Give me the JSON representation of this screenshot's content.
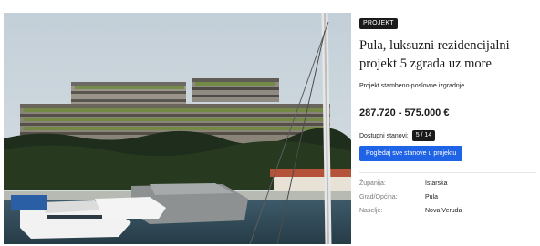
{
  "badge": "PROJEKT",
  "title": "Pula, luksuzni rezidencijalni projekt 5 zgrada uz more",
  "subtitle": "Projekt stambeno-poslovne izgradnje",
  "price": "287.720 - 575.000 €",
  "availability": {
    "label": "Dostupni stanovi:",
    "count": "5 / 14"
  },
  "cta_label": "Pogledaj sve stanove u projektu",
  "details": [
    {
      "key": "Županija:",
      "value": "Istarska"
    },
    {
      "key": "Grad/Općina:",
      "value": "Pula"
    },
    {
      "key": "Naselje:",
      "value": "Nova Veruda"
    }
  ],
  "colors": {
    "accent": "#1f63e6",
    "badge_bg": "#1a1a1a"
  },
  "image_alt": "project-photo"
}
